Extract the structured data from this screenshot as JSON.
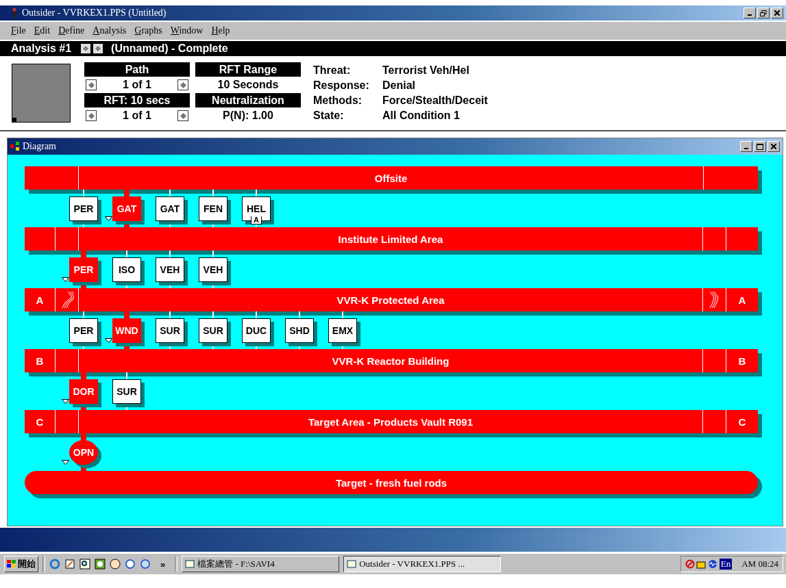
{
  "window": {
    "title": "Outsider - VVRKEX1.PPS (Untitled)"
  },
  "menu": [
    {
      "key": "F",
      "rest": "ile"
    },
    {
      "key": "E",
      "rest": "dit"
    },
    {
      "key": "D",
      "rest": "efine"
    },
    {
      "key": "A",
      "rest": "nalysis"
    },
    {
      "key": "G",
      "rest": "raphs"
    },
    {
      "key": "W",
      "rest": "indow"
    },
    {
      "key": "H",
      "rest": "elp"
    }
  ],
  "analysis_bar": {
    "title": "Analysis #1",
    "status": "(Unnamed) - Complete"
  },
  "summary": {
    "columns": [
      {
        "header": "Path",
        "value": "1 of 1",
        "spin": true
      },
      {
        "header": "RFT Range",
        "value": "10 Seconds",
        "spin": false
      },
      {
        "header": "RFT: 10 secs",
        "value": "1 of 1",
        "spin": true
      },
      {
        "header": "Neutralization",
        "value": "P(N): 1.00",
        "spin": false
      }
    ],
    "details": [
      {
        "label": "Threat:",
        "value": "Terrorist Veh/Hel"
      },
      {
        "label": "Response:",
        "value": "Denial"
      },
      {
        "label": "Methods:",
        "value": "Force/Stealth/Deceit"
      },
      {
        "label": "State:",
        "value": "All Condition 1"
      }
    ]
  },
  "diagram": {
    "title": "Diagram",
    "layers": [
      {
        "name": "Offsite",
        "kind": "outer",
        "elements": [
          {
            "code": "PER",
            "kind": "box",
            "selected": false
          },
          {
            "code": "GAT",
            "kind": "box",
            "selected": true
          },
          {
            "code": "GAT",
            "kind": "box",
            "selected": false
          },
          {
            "code": "FEN",
            "kind": "box",
            "selected": false
          },
          {
            "code": "HEL",
            "kind": "box",
            "selected": false,
            "tag": "A"
          }
        ]
      },
      {
        "name": "Institute Limited Area",
        "kind": "area",
        "elements": [
          {
            "code": "PER",
            "kind": "box",
            "selected": true
          },
          {
            "code": "ISO",
            "kind": "box",
            "selected": false
          },
          {
            "code": "VEH",
            "kind": "box",
            "selected": false
          },
          {
            "code": "VEH",
            "kind": "box",
            "selected": false
          }
        ]
      },
      {
        "name": "VVR-K Protected Area",
        "kind": "fenced",
        "left_label": "A",
        "right_label": "A",
        "elements": [
          {
            "code": "PER",
            "kind": "box",
            "selected": false
          },
          {
            "code": "WND",
            "kind": "box",
            "selected": true
          },
          {
            "code": "SUR",
            "kind": "box",
            "selected": false
          },
          {
            "code": "SUR",
            "kind": "box",
            "selected": false
          },
          {
            "code": "DUC",
            "kind": "box",
            "selected": false
          },
          {
            "code": "SHD",
            "kind": "box",
            "selected": false
          },
          {
            "code": "EMX",
            "kind": "box",
            "selected": false
          }
        ]
      },
      {
        "name": "VVR-K Reactor Building",
        "kind": "area",
        "left_label": "B",
        "right_label": "B",
        "elements": [
          {
            "code": "DOR",
            "kind": "box",
            "selected": true
          },
          {
            "code": "SUR",
            "kind": "box",
            "selected": false
          }
        ]
      },
      {
        "name": "Target Area - Products Vault R091",
        "kind": "area",
        "left_label": "C",
        "right_label": "C",
        "elements": [
          {
            "code": "OPN",
            "kind": "round",
            "selected": true
          }
        ]
      },
      {
        "name": "Target - fresh fuel rods",
        "kind": "target"
      }
    ]
  },
  "taskbar": {
    "start": "開始",
    "more": "»",
    "tasks": [
      {
        "label": "檔案總管 - F:\\SAVI4",
        "selected": false
      },
      {
        "label": "Outsider - VVRKEX1.PPS ...",
        "selected": true
      }
    ],
    "language": "En",
    "clock": "AM 08:24"
  }
}
